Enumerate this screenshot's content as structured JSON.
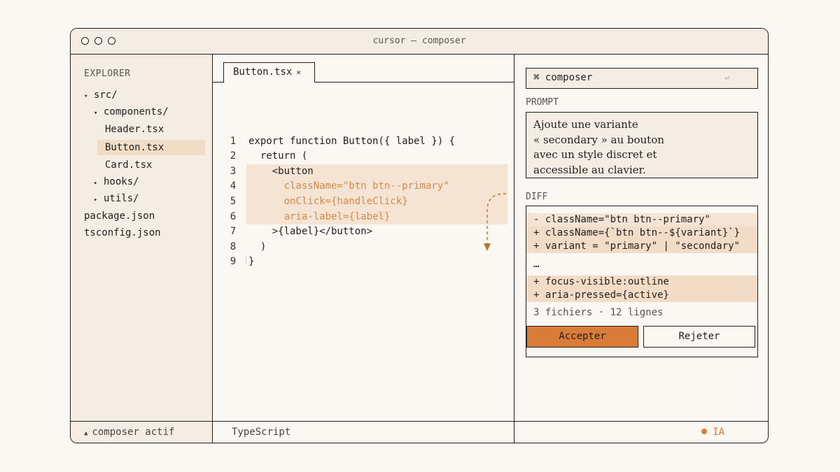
{
  "window": {
    "title": "cursor — composer"
  },
  "sidebar": {
    "title": "EXPLORER",
    "items": [
      {
        "caret": "▾",
        "label": "src/"
      },
      {
        "caret": "▾",
        "label": "components/"
      },
      {
        "caret": "",
        "label": "Header.tsx"
      },
      {
        "caret": "",
        "label": "Button.tsx",
        "selected": true
      },
      {
        "caret": "",
        "label": "Card.tsx"
      },
      {
        "caret": "▸",
        "label": "hooks/"
      },
      {
        "caret": "▸",
        "label": "utils/"
      },
      {
        "caret": "",
        "label": "package.json"
      },
      {
        "caret": "",
        "label": "tsconfig.json"
      }
    ]
  },
  "editor": {
    "tab": {
      "label": "Button.tsx",
      "close": "×"
    },
    "lines": [
      {
        "n": "1",
        "code": "export function Button({ label }) {"
      },
      {
        "n": "2",
        "code": "  return ("
      },
      {
        "n": "3",
        "code": "    <button"
      },
      {
        "n": "4",
        "code": "      className=\"btn btn--primary\"",
        "highlight": true,
        "accent": true
      },
      {
        "n": "5",
        "code": "      onClick={handleClick}",
        "highlight": true,
        "accent": true
      },
      {
        "n": "6",
        "code": "      aria-label={label}",
        "highlight": true,
        "accent": true
      },
      {
        "n": "7",
        "code": "    >{label}</button>",
        "highlight": true
      },
      {
        "n": "8",
        "code": "  )"
      },
      {
        "n": "9",
        "code": "}"
      }
    ]
  },
  "composer": {
    "command": "⌘ composer",
    "return_icon": "⏎",
    "prompt_label": "PROMPT",
    "prompt_lines": [
      "Ajoute une variante",
      "« secondary » au bouton",
      "avec un style discret et",
      "accessible au clavier."
    ],
    "diff_label": "DIFF",
    "diff_lines": [
      {
        "kind": "rem",
        "text": "- className=\"btn btn--primary\""
      },
      {
        "kind": "add",
        "text": "+ className={`btn btn--${variant}`}"
      },
      {
        "kind": "add",
        "text": "+ variant = \"primary\" | \"secondary\""
      },
      {
        "kind": "plain",
        "text": "…"
      },
      {
        "kind": "add",
        "text": "+ focus-visible:outline"
      },
      {
        "kind": "add",
        "text": "+ aria-pressed={active}"
      }
    ],
    "stats": "3 fichiers · 12 lignes",
    "accept_label": "Accepter",
    "reject_label": "Rejeter"
  },
  "status": {
    "left_icon": "▲",
    "left": "composer actif",
    "language": "TypeScript",
    "ai": "IA"
  },
  "colors": {
    "accent": "#d97c3a",
    "panel_bg": "#f5ede3",
    "highlight": "#f5e4d3"
  }
}
